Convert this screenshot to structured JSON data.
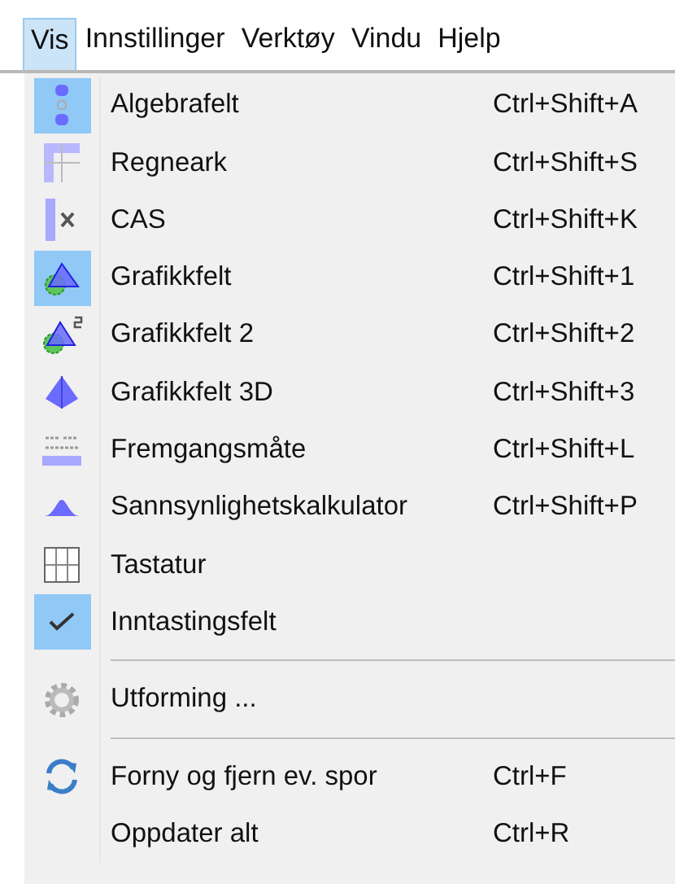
{
  "menubar": [
    {
      "label": "Vis",
      "selected": true
    },
    {
      "label": "Innstillinger",
      "selected": false
    },
    {
      "label": "Verktøy",
      "selected": false
    },
    {
      "label": "Vindu",
      "selected": false
    },
    {
      "label": "Hjelp",
      "selected": false
    }
  ],
  "menu": {
    "sections": [
      [
        {
          "label": "Algebrafelt",
          "shortcut": "Ctrl+Shift+A",
          "checked": true
        },
        {
          "label": "Regneark",
          "shortcut": "Ctrl+Shift+S",
          "checked": false
        },
        {
          "label": "CAS",
          "shortcut": "Ctrl+Shift+K",
          "checked": false
        },
        {
          "label": "Grafikkfelt",
          "shortcut": "Ctrl+Shift+1",
          "checked": true
        },
        {
          "label": "Grafikkfelt 2",
          "shortcut": "Ctrl+Shift+2",
          "checked": false
        },
        {
          "label": "Grafikkfelt 3D",
          "shortcut": "Ctrl+Shift+3",
          "checked": false
        },
        {
          "label": "Fremgangsmåte",
          "shortcut": "Ctrl+Shift+L",
          "checked": false
        },
        {
          "label": "Sannsynlighetskalkulator",
          "shortcut": "Ctrl+Shift+P",
          "checked": false
        },
        {
          "label": "Tastatur",
          "checked": false
        },
        {
          "label": "Inntastingsfelt",
          "checked": true
        }
      ],
      [
        {
          "label": "Utforming ..."
        }
      ],
      [
        {
          "label": "Forny og fjern ev. spor",
          "shortcut": "Ctrl+F"
        },
        {
          "label": "Oppdater alt",
          "shortcut": "Ctrl+R"
        }
      ]
    ]
  }
}
